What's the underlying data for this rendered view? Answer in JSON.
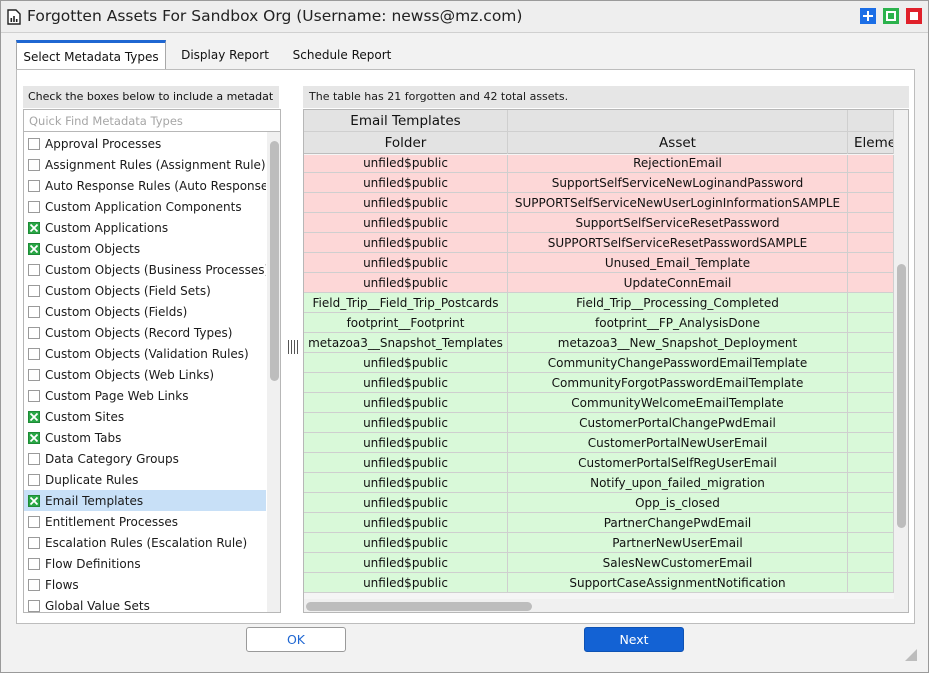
{
  "window": {
    "title": "Forgotten Assets For Sandbox Org (Username: newss@mz.com)"
  },
  "tabs": [
    {
      "label": "Select Metadata Types",
      "active": true
    },
    {
      "label": "Display Report",
      "active": false
    },
    {
      "label": "Schedule Report",
      "active": false
    }
  ],
  "left_panel": {
    "header": "Check the boxes below to include a metadat",
    "search_placeholder": "Quick Find Metadata Types",
    "items": [
      {
        "label": "Approval Processes",
        "checked": false
      },
      {
        "label": "Assignment Rules (Assignment Rule)",
        "checked": false
      },
      {
        "label": "Auto Response Rules (Auto Response",
        "checked": false
      },
      {
        "label": "Custom Application Components",
        "checked": false
      },
      {
        "label": "Custom Applications",
        "checked": true
      },
      {
        "label": "Custom Objects",
        "checked": true
      },
      {
        "label": "Custom Objects (Business Processes)",
        "checked": false
      },
      {
        "label": "Custom Objects (Field Sets)",
        "checked": false
      },
      {
        "label": "Custom Objects (Fields)",
        "checked": false
      },
      {
        "label": "Custom Objects (Record Types)",
        "checked": false
      },
      {
        "label": "Custom Objects (Validation Rules)",
        "checked": false
      },
      {
        "label": "Custom Objects (Web Links)",
        "checked": false
      },
      {
        "label": "Custom Page Web Links",
        "checked": false
      },
      {
        "label": "Custom Sites",
        "checked": true
      },
      {
        "label": "Custom Tabs",
        "checked": true
      },
      {
        "label": "Data Category Groups",
        "checked": false
      },
      {
        "label": "Duplicate Rules",
        "checked": false
      },
      {
        "label": "Email Templates",
        "checked": true,
        "selected": true
      },
      {
        "label": "Entitlement Processes",
        "checked": false
      },
      {
        "label": "Escalation Rules (Escalation Rule)",
        "checked": false
      },
      {
        "label": "Flow Definitions",
        "checked": false
      },
      {
        "label": "Flows",
        "checked": false
      },
      {
        "label": "Global Value Sets",
        "checked": false
      }
    ]
  },
  "right_panel": {
    "summary": "The table has 21 forgotten and 42 total assets.",
    "group_header": "Email Templates",
    "columns": [
      "Folder",
      "Asset",
      "Eleme"
    ],
    "rows": [
      {
        "folder": "unfiled$public",
        "asset": "RejectionEmail",
        "status": "forgotten"
      },
      {
        "folder": "unfiled$public",
        "asset": "SupportSelfServiceNewLoginandPassword",
        "status": "forgotten"
      },
      {
        "folder": "unfiled$public",
        "asset": "SUPPORTSelfServiceNewUserLoginInformationSAMPLE",
        "status": "forgotten"
      },
      {
        "folder": "unfiled$public",
        "asset": "SupportSelfServiceResetPassword",
        "status": "forgotten"
      },
      {
        "folder": "unfiled$public",
        "asset": "SUPPORTSelfServiceResetPasswordSAMPLE",
        "status": "forgotten"
      },
      {
        "folder": "unfiled$public",
        "asset": "Unused_Email_Template",
        "status": "forgotten"
      },
      {
        "folder": "unfiled$public",
        "asset": "UpdateConnEmail",
        "status": "forgotten"
      },
      {
        "folder": "Field_Trip__Field_Trip_Postcards",
        "asset": "Field_Trip__Processing_Completed",
        "status": "used"
      },
      {
        "folder": "footprint__Footprint",
        "asset": "footprint__FP_AnalysisDone",
        "status": "used"
      },
      {
        "folder": "metazoa3__Snapshot_Templates",
        "asset": "metazoa3__New_Snapshot_Deployment",
        "status": "used"
      },
      {
        "folder": "unfiled$public",
        "asset": "CommunityChangePasswordEmailTemplate",
        "status": "used"
      },
      {
        "folder": "unfiled$public",
        "asset": "CommunityForgotPasswordEmailTemplate",
        "status": "used"
      },
      {
        "folder": "unfiled$public",
        "asset": "CommunityWelcomeEmailTemplate",
        "status": "used"
      },
      {
        "folder": "unfiled$public",
        "asset": "CustomerPortalChangePwdEmail",
        "status": "used"
      },
      {
        "folder": "unfiled$public",
        "asset": "CustomerPortalNewUserEmail",
        "status": "used"
      },
      {
        "folder": "unfiled$public",
        "asset": "CustomerPortalSelfRegUserEmail",
        "status": "used"
      },
      {
        "folder": "unfiled$public",
        "asset": "Notify_upon_failed_migration",
        "status": "used"
      },
      {
        "folder": "unfiled$public",
        "asset": "Opp_is_closed",
        "status": "used"
      },
      {
        "folder": "unfiled$public",
        "asset": "PartnerChangePwdEmail",
        "status": "used"
      },
      {
        "folder": "unfiled$public",
        "asset": "PartnerNewUserEmail",
        "status": "used"
      },
      {
        "folder": "unfiled$public",
        "asset": "SalesNewCustomerEmail",
        "status": "used"
      },
      {
        "folder": "unfiled$public",
        "asset": "SupportCaseAssignmentNotification",
        "status": "used"
      }
    ]
  },
  "buttons": {
    "ok": "OK",
    "next": "Next"
  },
  "colors": {
    "accent": "#1362d4",
    "forgotten_row": "#fdd7d7",
    "used_row": "#d9f9d9",
    "selected_item": "#c8e0f7",
    "checked": "#28a745"
  }
}
